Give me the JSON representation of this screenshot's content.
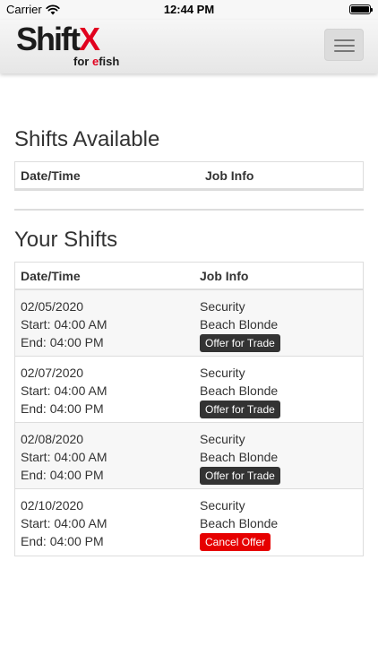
{
  "status_bar": {
    "carrier": "Carrier",
    "time": "12:44 PM"
  },
  "header": {
    "logo_main": "Shift",
    "logo_x": "X",
    "logo_sub_prefix": "for ",
    "logo_sub_e": "e",
    "logo_sub_suffix": "fish"
  },
  "shifts_available": {
    "title": "Shifts Available",
    "columns": [
      "Date/Time",
      "Job Info"
    ]
  },
  "your_shifts": {
    "title": "Your Shifts",
    "columns": [
      "Date/Time",
      "Job Info"
    ],
    "rows": [
      {
        "date": "02/05/2020",
        "start": "Start: 04:00 AM",
        "end": "End: 04:00 PM",
        "job": "Security",
        "location": "Beach Blonde",
        "action": "Offer for Trade",
        "action_type": "offer"
      },
      {
        "date": "02/07/2020",
        "start": "Start: 04:00 AM",
        "end": "End: 04:00 PM",
        "job": "Security",
        "location": "Beach Blonde",
        "action": "Offer for Trade",
        "action_type": "offer"
      },
      {
        "date": "02/08/2020",
        "start": "Start: 04:00 AM",
        "end": "End: 04:00 PM",
        "job": "Security",
        "location": "Beach Blonde",
        "action": "Offer for Trade",
        "action_type": "offer"
      },
      {
        "date": "02/10/2020",
        "start": "Start: 04:00 AM",
        "end": "End: 04:00 PM",
        "job": "Security",
        "location": "Beach Blonde",
        "action": "Cancel Offer",
        "action_type": "cancel"
      }
    ]
  },
  "colors": {
    "brand_red": "#e1001e",
    "button_dark": "#333333",
    "button_cancel": "#e60000"
  },
  "icons": {
    "signal": "wifi-icon",
    "battery": "battery-icon",
    "menu": "hamburger-menu-icon"
  }
}
